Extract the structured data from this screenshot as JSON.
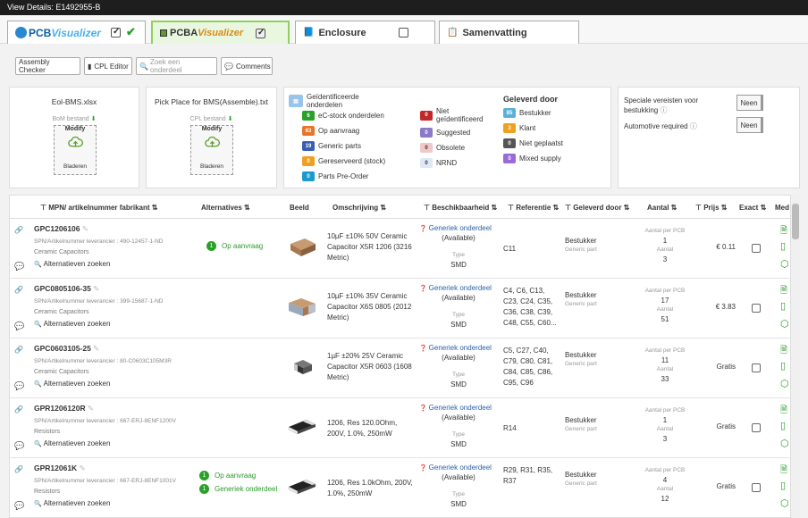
{
  "window": {
    "title": "View Details: E1492955-B"
  },
  "tabs": [
    {
      "logo_prefix": "PCB",
      "logo_suffix": "Visualizer"
    },
    {
      "logo_prefix": "PCBA",
      "logo_suffix": "Visualizer"
    },
    {
      "label": "Enclosure"
    },
    {
      "label": "Samenvatting"
    }
  ],
  "toolbar": {
    "assembly": "Assembly Checker",
    "cpl": "CPL Editor",
    "search": "Zoek een onderdeel",
    "comments": "Comments"
  },
  "files": [
    {
      "name": "Eol-BMS.xlsx",
      "status": "BoM bestand",
      "modify": "Modify",
      "browse": "Bladeren"
    },
    {
      "name": "Pick Place for BMS(Assemble).txt",
      "status": "CPL bestand",
      "modify": "Modify",
      "browse": "Bladeren"
    }
  ],
  "legend": {
    "identified": "Geïdentificeerde onderdelen",
    "items": [
      {
        "count": "6",
        "label": "eC-stock onderdelen",
        "color": "#2aa02a"
      },
      {
        "count": "63",
        "label": "Op aanvraag",
        "color": "#e8762a"
      },
      {
        "count": "19",
        "label": "Generic parts",
        "color": "#3a5fb0"
      },
      {
        "count": "0",
        "label": "Gereserveerd (stock)",
        "color": "#f0a020"
      },
      {
        "count": "0",
        "label": "Parts Pre-Order",
        "color": "#1c9ad0"
      }
    ],
    "not_identified": [
      {
        "count": "0",
        "label": "Niet geïdentificeerd",
        "color": "#c0282a"
      },
      {
        "count": "0",
        "label": "Suggested",
        "color": "#8a7ac8"
      },
      {
        "count": "0",
        "label": "Obsolete",
        "color": "#f0c8c8",
        "text": "#333"
      },
      {
        "count": "0",
        "label": "NRND",
        "color": "#dfe8f5",
        "text": "#333"
      }
    ],
    "delivered_title": "Geleverd door",
    "delivered": [
      {
        "count": "85",
        "label": "Bestukker",
        "color": "#5cb0d8"
      },
      {
        "count": "3",
        "label": "Klant",
        "color": "#f0a020"
      },
      {
        "count": "0",
        "label": "Niet geplaatst",
        "color": "#555"
      },
      {
        "count": "0",
        "label": "Mixed supply",
        "color": "#9a6ad8"
      }
    ]
  },
  "requirements": {
    "special": "Speciale vereisten voor bestukking",
    "automotive": "Automotive required",
    "special_value": "Neen",
    "automotive_value": "Neen"
  },
  "columns": [
    "MPN/ artikelnummer fabrikant",
    "Alternatives",
    "Beeld",
    "Omschrijving",
    "Beschikbaarheid",
    "Referentie",
    "Geleverd door",
    "Aantal",
    "Prijs",
    "Exact",
    "Media"
  ],
  "rows": [
    {
      "mpn": "GPC1206106",
      "spn": "SPN/Artikelnummer leverancier : 490-12457-1-ND",
      "cat": "Ceramic Capacitors",
      "alt_search": "Alternatieven zoeken",
      "alts": [
        {
          "n": "1",
          "t": "Op aanvraag"
        }
      ],
      "desc": "10µF ±10% 50V Ceramic Capacitor X5R 1206 (3216 Metric)",
      "avail_link": "Generiek onderdeel",
      "avail": "(Available)",
      "type_label": "Type",
      "type": "SMD",
      "ref": "C11",
      "by": "Bestukker",
      "by2": "Generic part",
      "per_pcb": "Aantal per PCB",
      "qty_pcb": "1",
      "qty_label": "Aantal",
      "qty": "3",
      "price": "€ 0.11",
      "img": "brown"
    },
    {
      "mpn": "GPC0805106-35",
      "spn": "SPN/Artikelnummer leverancier : 399-15687-1-ND",
      "cat": "Ceramic Capacitors",
      "alt_search": "Alternatieven zoeken",
      "alts": [],
      "desc": "10µF ±10% 35V Ceramic Capacitor X6S 0805 (2012 Metric)",
      "avail_link": "Generiek onderdeel",
      "avail": "(Available)",
      "type_label": "Type",
      "type": "SMD",
      "ref": "C4, C6, C13, C23, C24, C35, C36, C38, C39, C48, C55, C60...",
      "by": "Bestukker",
      "by2": "Generic part",
      "per_pcb": "Aantal per PCB",
      "qty_pcb": "17",
      "qty_label": "Aantal",
      "qty": "51",
      "price": "€ 3.83",
      "img": "brown2"
    },
    {
      "mpn": "GPC0603105-25",
      "spn": "SPN/Artikelnummer leverancier : 80-C0603C105M3R",
      "cat": "Ceramic Capacitors",
      "alt_search": "Alternatieven zoeken",
      "alts": [],
      "desc": "1µF ±20% 25V Ceramic Capacitor X5R 0603 (1608 Metric)",
      "avail_link": "Generiek onderdeel",
      "avail": "(Available)",
      "type_label": "Type",
      "type": "SMD",
      "ref": "C5, C27, C40, C79, C80, C81, C84, C85, C86, C95, C96",
      "by": "Bestukker",
      "by2": "Generic part",
      "per_pcb": "Aantal per PCB",
      "qty_pcb": "11",
      "qty_label": "Aantal",
      "qty": "33",
      "price": "Gratis",
      "img": "dark"
    },
    {
      "mpn": "GPR1206120R",
      "spn": "SPN/Artikelnummer leverancier : 667-ERJ-8ENF1200V",
      "cat": "Resistors",
      "alt_search": "Alternatieven zoeken",
      "alts": [],
      "desc": "1206, Res 120.0Ohm, 200V, 1.0%, 250mW",
      "avail_link": "Generiek onderdeel",
      "avail": "(Available)",
      "type_label": "Type",
      "type": "SMD",
      "ref": "R14",
      "by": "Bestukker",
      "by2": "Generic part",
      "per_pcb": "Aantal per PCB",
      "qty_pcb": "1",
      "qty_label": "Aantal",
      "qty": "3",
      "price": "Gratis",
      "img": "res"
    },
    {
      "mpn": "GPR12061K",
      "spn": "SPN/Artikelnummer leverancier : 667-ERJ-8ENF1001V",
      "cat": "Resistors",
      "alt_search": "Alternatieven zoeken",
      "alts": [
        {
          "n": "1",
          "t": "Op aanvraag"
        },
        {
          "n": "1",
          "t": "Generiek onderdeel"
        }
      ],
      "desc": "1206, Res 1.0kOhm, 200V, 1.0%, 250mW",
      "avail_link": "Generiek onderdeel",
      "avail": "(Available)",
      "type_label": "Type",
      "type": "SMD",
      "ref": "R29, R31, R35, R37",
      "by": "Bestukker",
      "by2": "Generic part",
      "per_pcb": "Aantal per PCB",
      "qty_pcb": "4",
      "qty_label": "Aantal",
      "qty": "12",
      "price": "Gratis",
      "img": "res"
    }
  ]
}
